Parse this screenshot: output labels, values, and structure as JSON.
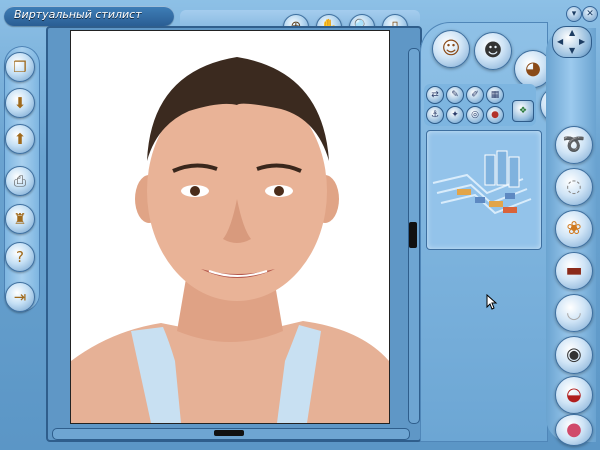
{
  "window": {
    "title": "Виртуальный стилист",
    "controls": [
      "chevron-down-icon",
      "close-icon"
    ]
  },
  "toolbar": {
    "top_buttons": [
      {
        "name": "crosshair-target-icon"
      },
      {
        "name": "hand-pan-icon"
      },
      {
        "name": "zoom-magnifier-icon"
      },
      {
        "name": "document-info-icon"
      }
    ]
  },
  "left_toolbar": {
    "buttons": [
      {
        "name": "open-cube-icon"
      },
      {
        "name": "import-box-icon"
      },
      {
        "name": "export-box-icon"
      },
      {
        "name": "print-icon"
      },
      {
        "name": "tools-icon"
      },
      {
        "name": "help-question-icon"
      },
      {
        "name": "exit-door-icon"
      }
    ]
  },
  "right_panel": {
    "category_buttons": [
      {
        "name": "hairstyle-woman-icon"
      },
      {
        "name": "hairstyle-man-icon"
      },
      {
        "name": "face-icon"
      },
      {
        "name": "eye-icon"
      }
    ],
    "small_tools": [
      {
        "name": "flip-icon"
      },
      {
        "name": "brush-icon"
      },
      {
        "name": "pencil-icon"
      },
      {
        "name": "grid-icon"
      },
      {
        "name": "anchor-icon"
      },
      {
        "name": "smudge-icon"
      },
      {
        "name": "blend-icon"
      },
      {
        "name": "palette-icon"
      },
      {
        "name": "layers-icon"
      }
    ],
    "side_buttons": [
      {
        "name": "hairpiece-icon"
      },
      {
        "name": "earring-icon"
      },
      {
        "name": "bow-accessory-icon"
      },
      {
        "name": "hat-icon"
      },
      {
        "name": "necklace-icon"
      },
      {
        "name": "eye-makeup-icon"
      },
      {
        "name": "lips-icon"
      },
      {
        "name": "nail-polish-icon"
      }
    ]
  }
}
